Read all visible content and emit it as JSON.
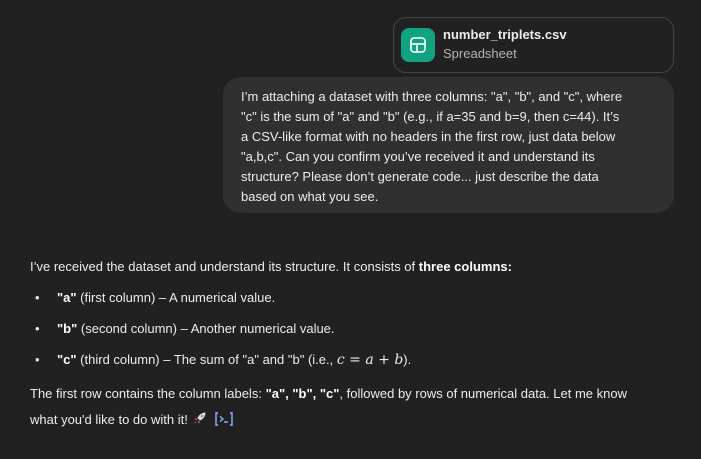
{
  "attachment": {
    "file_name": "number_triplets.csv",
    "file_type": "Spreadsheet",
    "icon": "spreadsheet-icon",
    "icon_color": "#10a37f"
  },
  "user_message": {
    "lines": [
      "I’m attaching a dataset with three columns: \"a\", \"b\", and \"c\", where",
      "\"c\" is the sum of \"a\" and \"b\" (e.g., if a=35 and b=9, then c=44). It’s",
      "a CSV-like format with no headers in the first row, just data below",
      "\"a,b,c\". Can you confirm you’ve received it and understand its",
      "structure? Please don’t generate code... just describe the data",
      "based on what you see."
    ]
  },
  "assistant_message": {
    "intro_text": "I’ve received the dataset and understand its structure. It consists of ",
    "intro_bold": "three columns:",
    "bullets": [
      {
        "bold": "\"a\"",
        "text": " (first column) – A numerical value."
      },
      {
        "bold": "\"b\"",
        "text": " (second column) – Another numerical value."
      },
      {
        "bold": "\"c\"",
        "text": " (third column) – The sum of \"a\" and \"b\" (i.e., ",
        "math_c": "c",
        "math_eq": " = ",
        "math_a": "a",
        "math_plus": " + ",
        "math_b": "b",
        "tail": ")."
      }
    ],
    "outro_1": "The first row contains the column labels: ",
    "outro_labels": "\"a\", \"b\", \"c\"",
    "outro_2": ", followed by rows of numerical data. Let me know",
    "outro_3": "what you'd like to do with it!",
    "emoji": "rocket-icon",
    "trailing_icon": "code-interpreter-icon",
    "accent_color": "#8ab4f8"
  }
}
